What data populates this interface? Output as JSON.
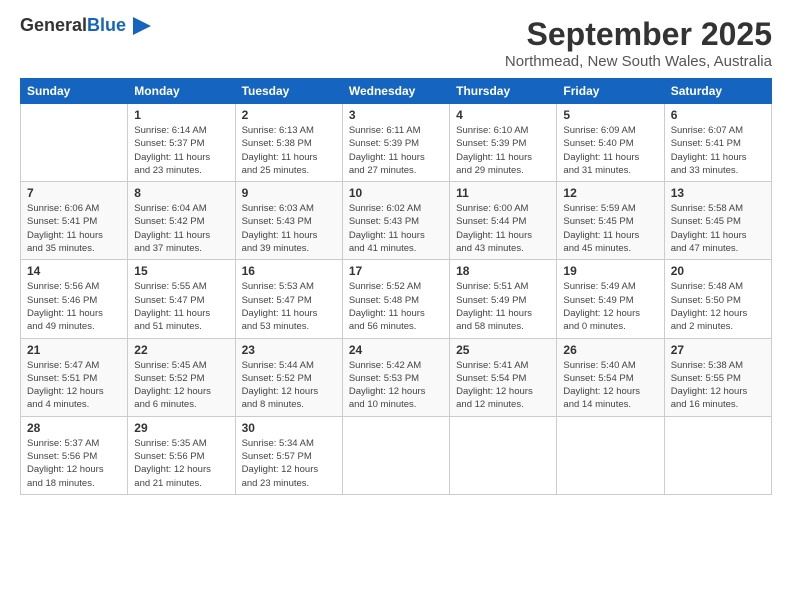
{
  "header": {
    "logo_general": "General",
    "logo_blue": "Blue",
    "month": "September 2025",
    "location": "Northmead, New South Wales, Australia"
  },
  "days_of_week": [
    "Sunday",
    "Monday",
    "Tuesday",
    "Wednesday",
    "Thursday",
    "Friday",
    "Saturday"
  ],
  "weeks": [
    [
      {
        "day": "",
        "info": ""
      },
      {
        "day": "1",
        "info": "Sunrise: 6:14 AM\nSunset: 5:37 PM\nDaylight: 11 hours\nand 23 minutes."
      },
      {
        "day": "2",
        "info": "Sunrise: 6:13 AM\nSunset: 5:38 PM\nDaylight: 11 hours\nand 25 minutes."
      },
      {
        "day": "3",
        "info": "Sunrise: 6:11 AM\nSunset: 5:39 PM\nDaylight: 11 hours\nand 27 minutes."
      },
      {
        "day": "4",
        "info": "Sunrise: 6:10 AM\nSunset: 5:39 PM\nDaylight: 11 hours\nand 29 minutes."
      },
      {
        "day": "5",
        "info": "Sunrise: 6:09 AM\nSunset: 5:40 PM\nDaylight: 11 hours\nand 31 minutes."
      },
      {
        "day": "6",
        "info": "Sunrise: 6:07 AM\nSunset: 5:41 PM\nDaylight: 11 hours\nand 33 minutes."
      }
    ],
    [
      {
        "day": "7",
        "info": "Sunrise: 6:06 AM\nSunset: 5:41 PM\nDaylight: 11 hours\nand 35 minutes."
      },
      {
        "day": "8",
        "info": "Sunrise: 6:04 AM\nSunset: 5:42 PM\nDaylight: 11 hours\nand 37 minutes."
      },
      {
        "day": "9",
        "info": "Sunrise: 6:03 AM\nSunset: 5:43 PM\nDaylight: 11 hours\nand 39 minutes."
      },
      {
        "day": "10",
        "info": "Sunrise: 6:02 AM\nSunset: 5:43 PM\nDaylight: 11 hours\nand 41 minutes."
      },
      {
        "day": "11",
        "info": "Sunrise: 6:00 AM\nSunset: 5:44 PM\nDaylight: 11 hours\nand 43 minutes."
      },
      {
        "day": "12",
        "info": "Sunrise: 5:59 AM\nSunset: 5:45 PM\nDaylight: 11 hours\nand 45 minutes."
      },
      {
        "day": "13",
        "info": "Sunrise: 5:58 AM\nSunset: 5:45 PM\nDaylight: 11 hours\nand 47 minutes."
      }
    ],
    [
      {
        "day": "14",
        "info": "Sunrise: 5:56 AM\nSunset: 5:46 PM\nDaylight: 11 hours\nand 49 minutes."
      },
      {
        "day": "15",
        "info": "Sunrise: 5:55 AM\nSunset: 5:47 PM\nDaylight: 11 hours\nand 51 minutes."
      },
      {
        "day": "16",
        "info": "Sunrise: 5:53 AM\nSunset: 5:47 PM\nDaylight: 11 hours\nand 53 minutes."
      },
      {
        "day": "17",
        "info": "Sunrise: 5:52 AM\nSunset: 5:48 PM\nDaylight: 11 hours\nand 56 minutes."
      },
      {
        "day": "18",
        "info": "Sunrise: 5:51 AM\nSunset: 5:49 PM\nDaylight: 11 hours\nand 58 minutes."
      },
      {
        "day": "19",
        "info": "Sunrise: 5:49 AM\nSunset: 5:49 PM\nDaylight: 12 hours\nand 0 minutes."
      },
      {
        "day": "20",
        "info": "Sunrise: 5:48 AM\nSunset: 5:50 PM\nDaylight: 12 hours\nand 2 minutes."
      }
    ],
    [
      {
        "day": "21",
        "info": "Sunrise: 5:47 AM\nSunset: 5:51 PM\nDaylight: 12 hours\nand 4 minutes."
      },
      {
        "day": "22",
        "info": "Sunrise: 5:45 AM\nSunset: 5:52 PM\nDaylight: 12 hours\nand 6 minutes."
      },
      {
        "day": "23",
        "info": "Sunrise: 5:44 AM\nSunset: 5:52 PM\nDaylight: 12 hours\nand 8 minutes."
      },
      {
        "day": "24",
        "info": "Sunrise: 5:42 AM\nSunset: 5:53 PM\nDaylight: 12 hours\nand 10 minutes."
      },
      {
        "day": "25",
        "info": "Sunrise: 5:41 AM\nSunset: 5:54 PM\nDaylight: 12 hours\nand 12 minutes."
      },
      {
        "day": "26",
        "info": "Sunrise: 5:40 AM\nSunset: 5:54 PM\nDaylight: 12 hours\nand 14 minutes."
      },
      {
        "day": "27",
        "info": "Sunrise: 5:38 AM\nSunset: 5:55 PM\nDaylight: 12 hours\nand 16 minutes."
      }
    ],
    [
      {
        "day": "28",
        "info": "Sunrise: 5:37 AM\nSunset: 5:56 PM\nDaylight: 12 hours\nand 18 minutes."
      },
      {
        "day": "29",
        "info": "Sunrise: 5:35 AM\nSunset: 5:56 PM\nDaylight: 12 hours\nand 21 minutes."
      },
      {
        "day": "30",
        "info": "Sunrise: 5:34 AM\nSunset: 5:57 PM\nDaylight: 12 hours\nand 23 minutes."
      },
      {
        "day": "",
        "info": ""
      },
      {
        "day": "",
        "info": ""
      },
      {
        "day": "",
        "info": ""
      },
      {
        "day": "",
        "info": ""
      }
    ]
  ]
}
